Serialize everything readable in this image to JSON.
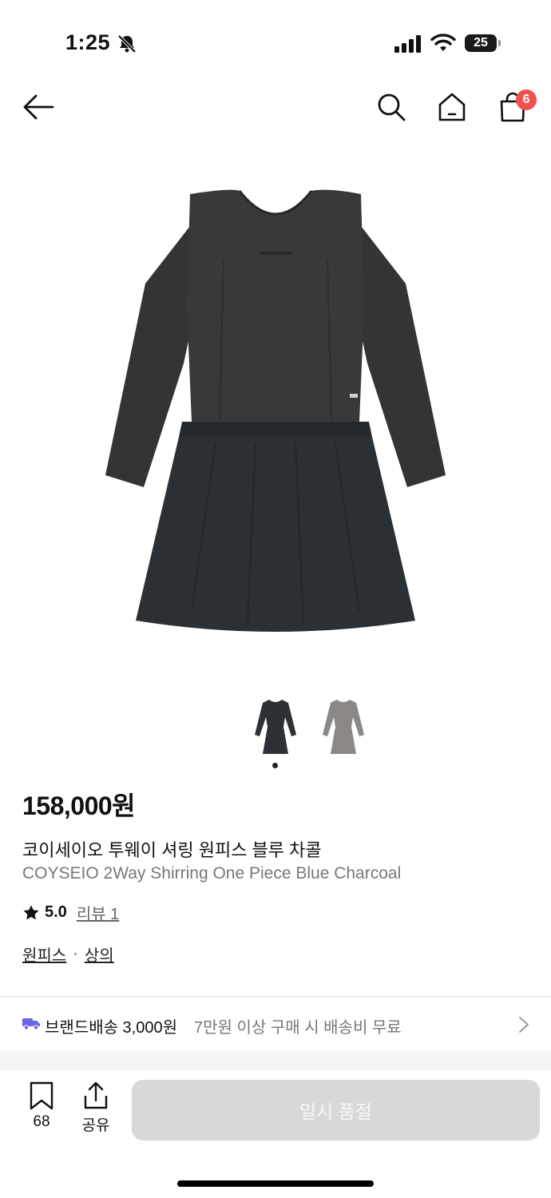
{
  "status_bar": {
    "time": "1:25",
    "battery": "25",
    "icons": [
      "bell-off-icon",
      "signal-icon",
      "wifi-icon",
      "battery-icon"
    ]
  },
  "nav": {
    "icons": [
      "back-arrow-icon",
      "search-icon",
      "home-icon",
      "shopping-bag-icon"
    ],
    "cart_count": "6"
  },
  "product": {
    "price": "158,000원",
    "title_ko": "코이세이오 투웨이 셔링 원피스 블루 차콜",
    "title_en": "COYSEIO 2Way Shirring One Piece Blue Charcoal",
    "rating": "5.0",
    "review_link": "리뷰 1",
    "categories": [
      "원피스",
      "상의"
    ],
    "category_separator": "·",
    "thumbnails": [
      "charcoal",
      "gray"
    ],
    "colors": {
      "charcoal": "#2d3135",
      "gray": "#8a8784"
    }
  },
  "shipping": {
    "label": "브랜드배송 3,000원",
    "note": "7만원 이상 구매 시 배송비 무료",
    "icon": "truck-icon",
    "accent": "#6b63e6"
  },
  "bottom_bar": {
    "bookmark_count": "68",
    "share_label": "공유",
    "cta_label": "일시 품절"
  }
}
